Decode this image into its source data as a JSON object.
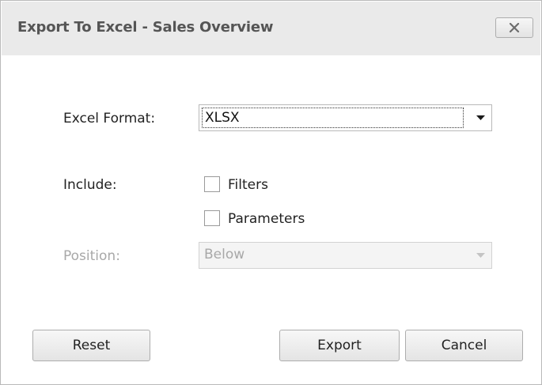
{
  "window": {
    "title": "Export To Excel - Sales Overview"
  },
  "form": {
    "excel_format_label": "Excel Format:",
    "excel_format_value": "XLSX",
    "include_label": "Include:",
    "filters_label": "Filters",
    "filters_checked": false,
    "parameters_label": "Parameters",
    "parameters_checked": false,
    "position_label": "Position:",
    "position_value": "Below",
    "position_enabled": false
  },
  "buttons": {
    "reset": "Reset",
    "export": "Export",
    "cancel": "Cancel"
  },
  "icons": {
    "close": "close-icon",
    "dropdown": "chevron-down-icon"
  }
}
